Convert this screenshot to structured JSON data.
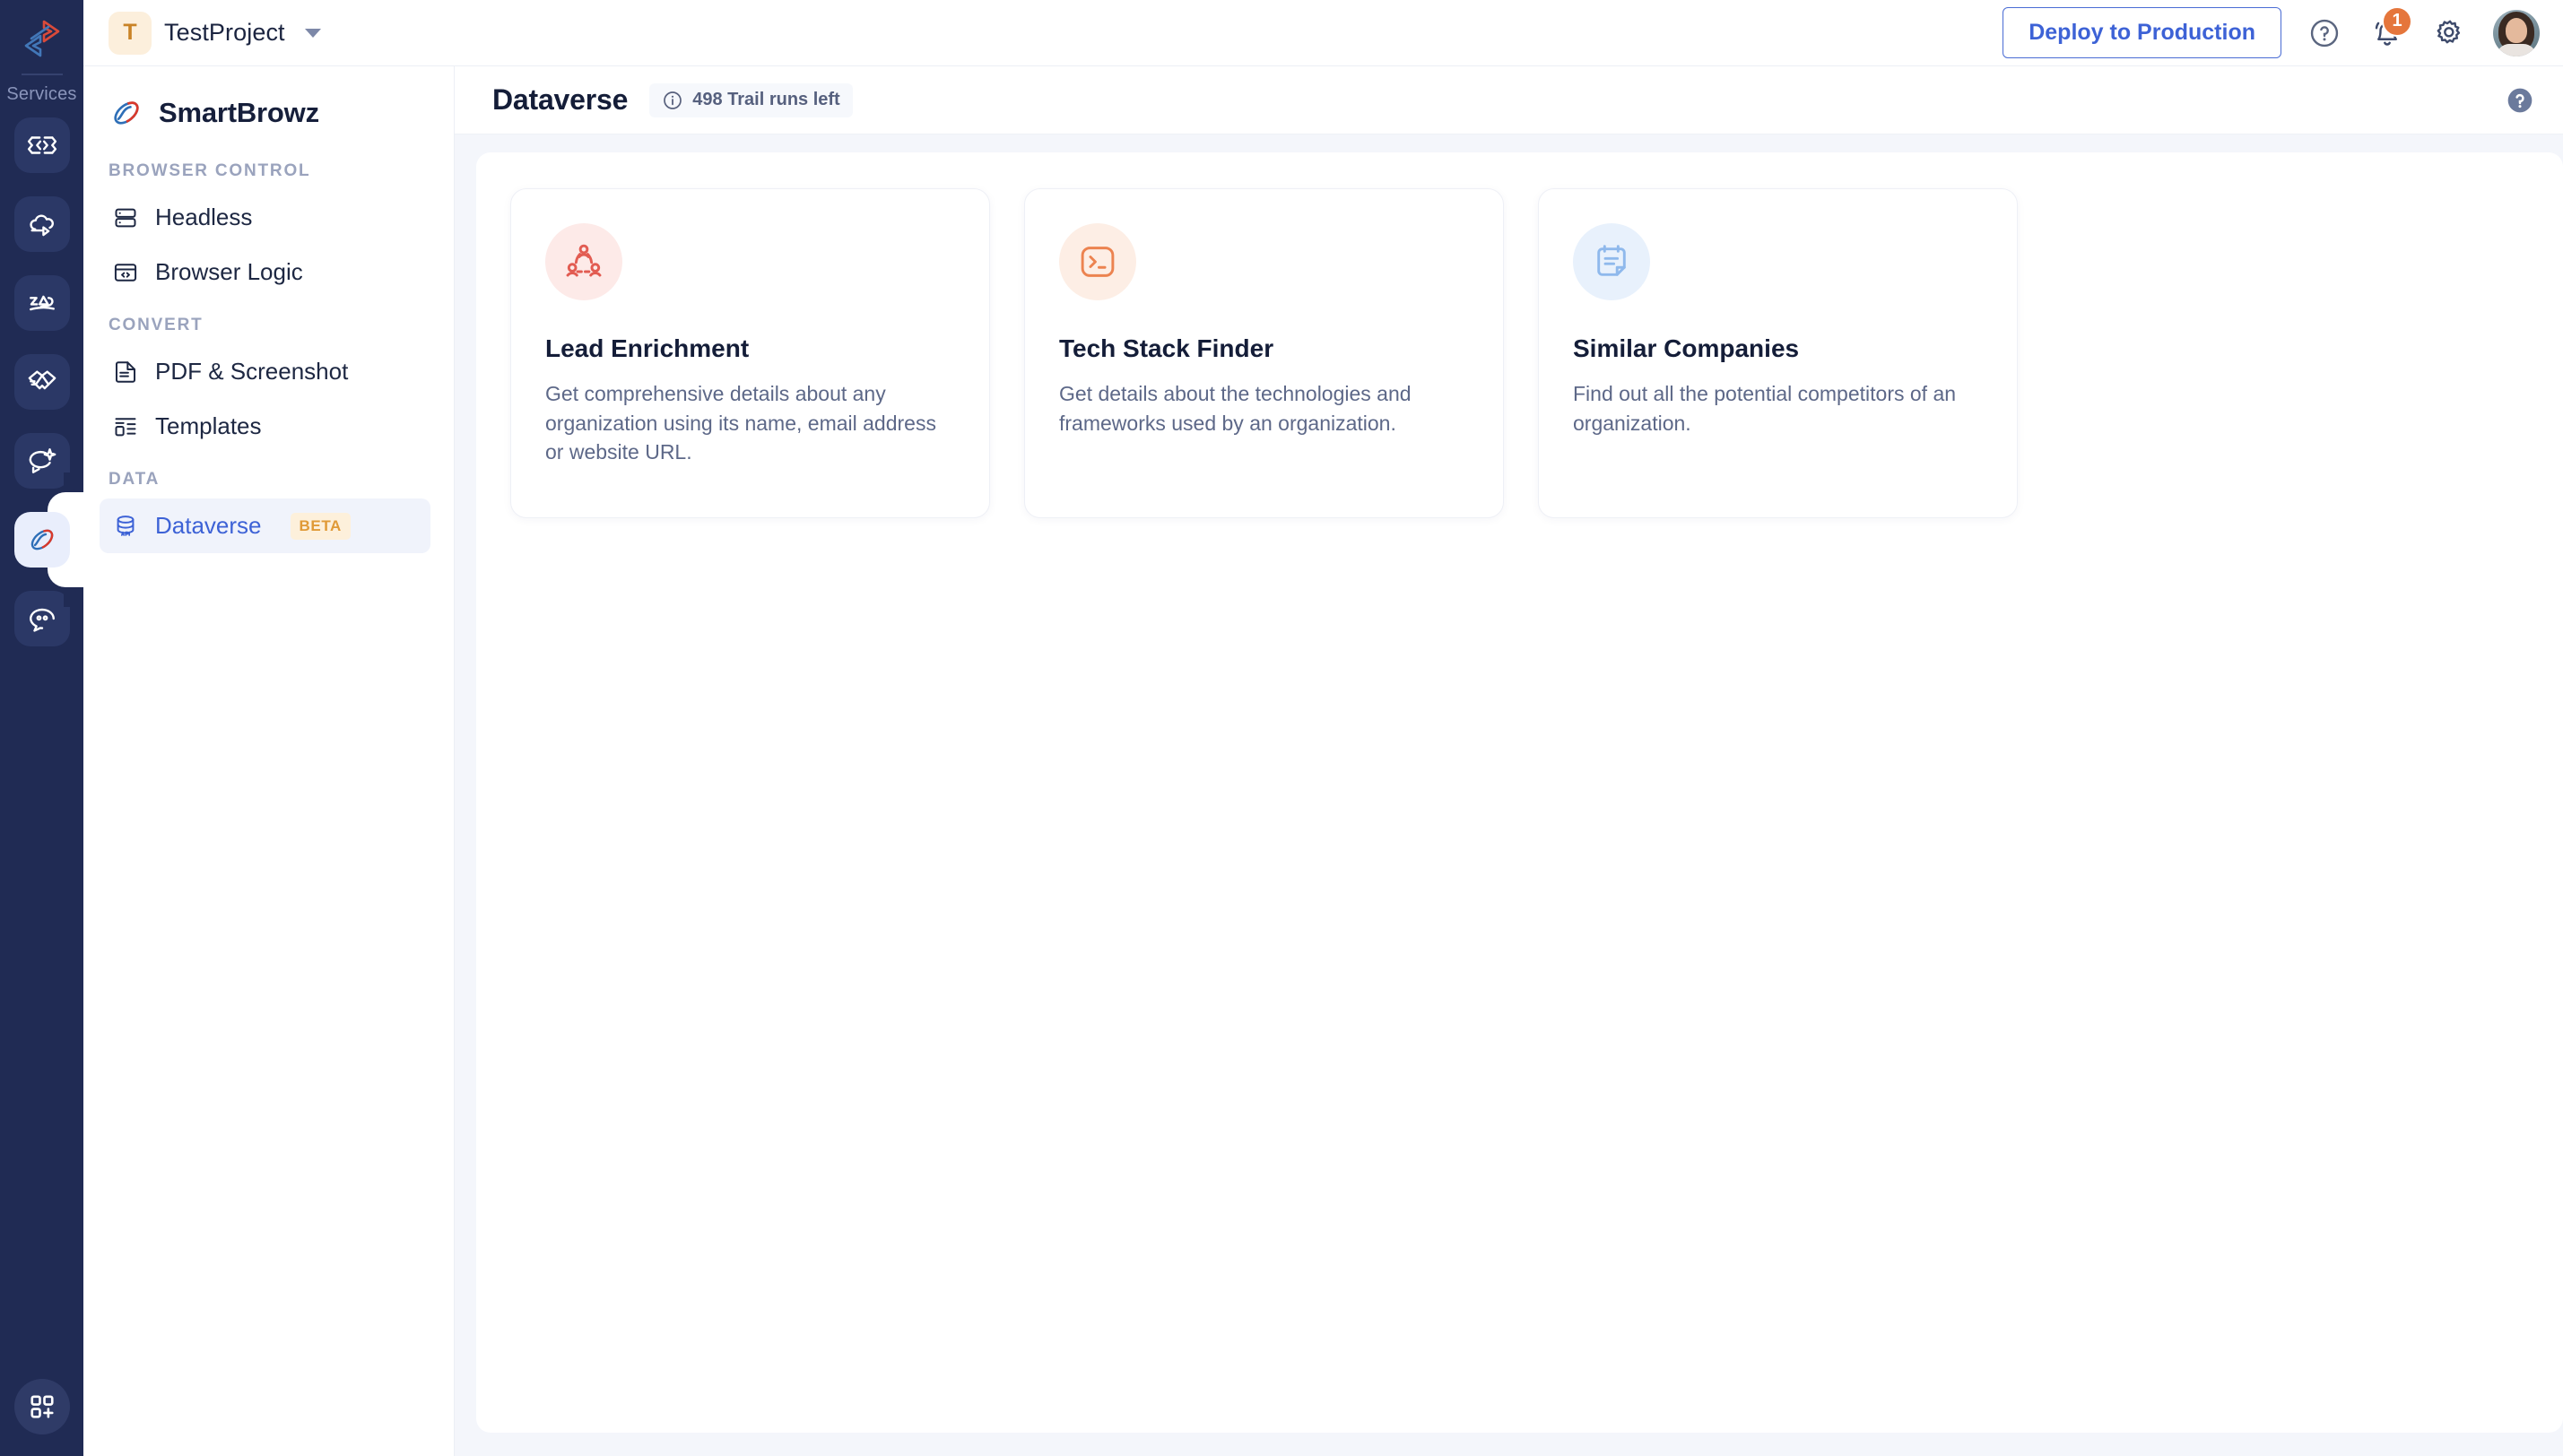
{
  "rail": {
    "logo_icon": "smartbrowz-arrow-logo",
    "services_label": "Services",
    "items": [
      {
        "icon": "code-brackets-icon",
        "name": "code",
        "active": false
      },
      {
        "icon": "cloud-upload-icon",
        "name": "cloud",
        "active": false
      },
      {
        "icon": "scribble-signature-icon",
        "name": "scribble",
        "active": false
      },
      {
        "icon": "handshake-icon",
        "name": "handshake",
        "active": false
      },
      {
        "icon": "chat-sparkle-icon",
        "name": "chat-sparkle",
        "active": false
      },
      {
        "icon": "smartbrowz-loop-icon",
        "name": "smartbrowz",
        "active": true
      },
      {
        "icon": "chat-smile-icon",
        "name": "chat-smile",
        "active": false
      }
    ],
    "bottom_icon": "grid-plus-icon"
  },
  "topbar": {
    "project_initial": "T",
    "project_name": "TestProject",
    "caret_icon": "chevron-down-icon",
    "deploy_label": "Deploy to Production",
    "help_icon": "help-circle-icon",
    "notifications_icon": "bell-icon",
    "notifications_count": "1",
    "settings_icon": "gear-icon",
    "avatar_icon": "user-avatar"
  },
  "sidebar": {
    "brand_name": "SmartBrowz",
    "brand_icon": "smartbrowz-loop-icon",
    "sections": [
      {
        "label": "BROWSER CONTROL",
        "items": [
          {
            "label": "Headless",
            "icon": "server-icon",
            "active": false,
            "badge": ""
          },
          {
            "label": "Browser Logic",
            "icon": "browser-code-icon",
            "active": false,
            "badge": ""
          }
        ]
      },
      {
        "label": "CONVERT",
        "items": [
          {
            "label": "PDF & Screenshot",
            "icon": "document-lines-icon",
            "active": false,
            "badge": ""
          },
          {
            "label": "Templates",
            "icon": "layout-list-icon",
            "active": false,
            "badge": ""
          }
        ]
      },
      {
        "label": "DATA",
        "items": [
          {
            "label": "Dataverse",
            "icon": "database-api-icon",
            "active": true,
            "badge": "BETA"
          }
        ]
      }
    ]
  },
  "content": {
    "page_title": "Dataverse",
    "trail_info_icon": "info-circle-icon",
    "trail_text": "498 Trail runs left",
    "help_icon": "help-circle-filled-icon",
    "cards": [
      {
        "title": "Lead Enrichment",
        "desc": "Get comprehensive details about any organization using its name, email address or website URL.",
        "icon": "people-network-icon",
        "icon_color": "#e25c52",
        "icon_bg": "#fdeae8"
      },
      {
        "title": "Tech Stack Finder",
        "desc": "Get details about the technologies and frameworks used by an organization.",
        "icon": "terminal-prompt-icon",
        "icon_color": "#ec8350",
        "icon_bg": "#fdeee5"
      },
      {
        "title": "Similar Companies",
        "desc": "Find out all the potential competitors of an organization.",
        "icon": "note-lines-icon",
        "icon_color": "#8fb9ec",
        "icon_bg": "#e8f1fc"
      }
    ]
  },
  "colors": {
    "rail_bg": "#202b54",
    "accent_blue": "#3d62d6",
    "badge_orange": "#e5763c",
    "beta_bg": "#fdf0db",
    "beta_text": "#e09a37",
    "canvas_bg": "#f4f6fb"
  }
}
